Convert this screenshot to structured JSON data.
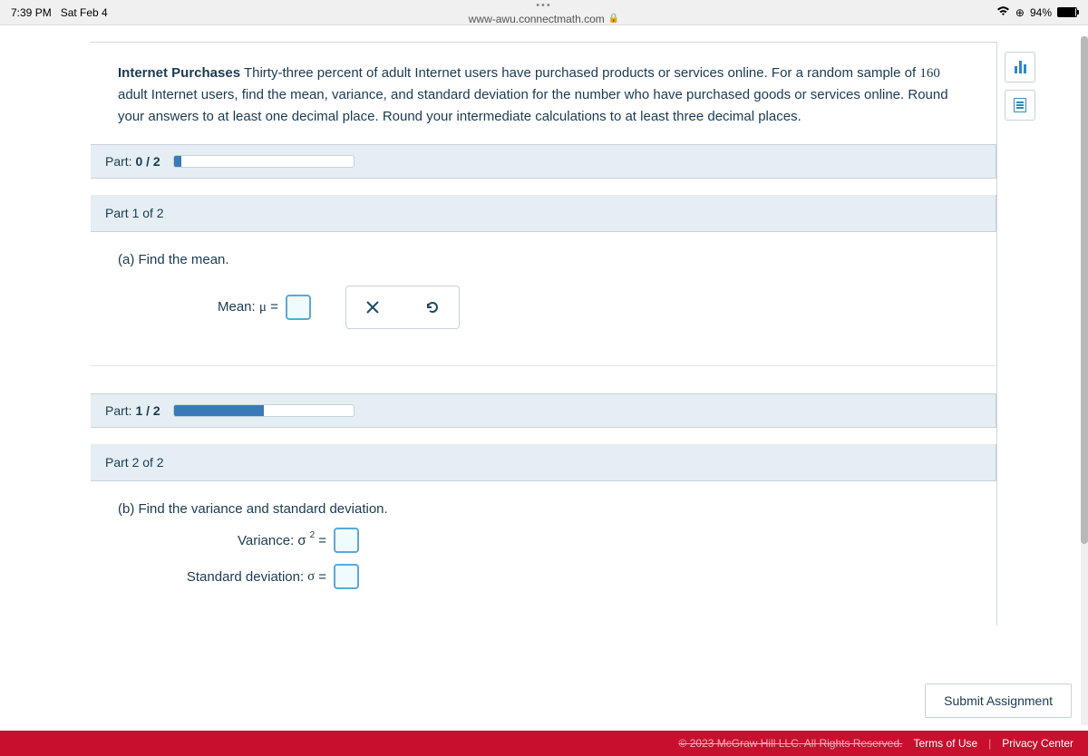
{
  "status": {
    "time": "7:39 PM",
    "date": "Sat Feb 4",
    "url": "www-awu.connectmath.com",
    "battery_pct": "94%"
  },
  "problem": {
    "title": "Internet Purchases",
    "text_1": " Thirty-three percent of adult Internet users have purchased products or services online. For a random sample of ",
    "sample_n": "160",
    "text_2": " adult Internet users, find the mean, variance, and standard deviation for the number who have purchased goods or services online. Round your answers to at least one decimal place. Round your intermediate calculations to at least three decimal places."
  },
  "parts": {
    "progress0": {
      "label": "Part:",
      "counter": "0 / 2",
      "fill_pct": 4
    },
    "part1": {
      "header": "Part 1 of 2",
      "prompt": "(a)  Find the mean.",
      "mean_label": "Mean: μ ="
    },
    "progress1": {
      "label": "Part:",
      "counter": "1 / 2",
      "fill_pct": 50
    },
    "part2": {
      "header": "Part 2 of 2",
      "prompt": "(b)  Find the variance and standard deviation.",
      "variance_label_pre": "Variance: σ",
      "variance_sup": "2",
      "variance_label_post": " =",
      "stddev_label": "Standard deviation: σ ="
    }
  },
  "footer": {
    "submit": "Submit Assignment",
    "copyright": "© 2023 McGraw Hill LLC. All Rights Reserved.",
    "terms": "Terms of Use",
    "privacy": "Privacy Center"
  }
}
